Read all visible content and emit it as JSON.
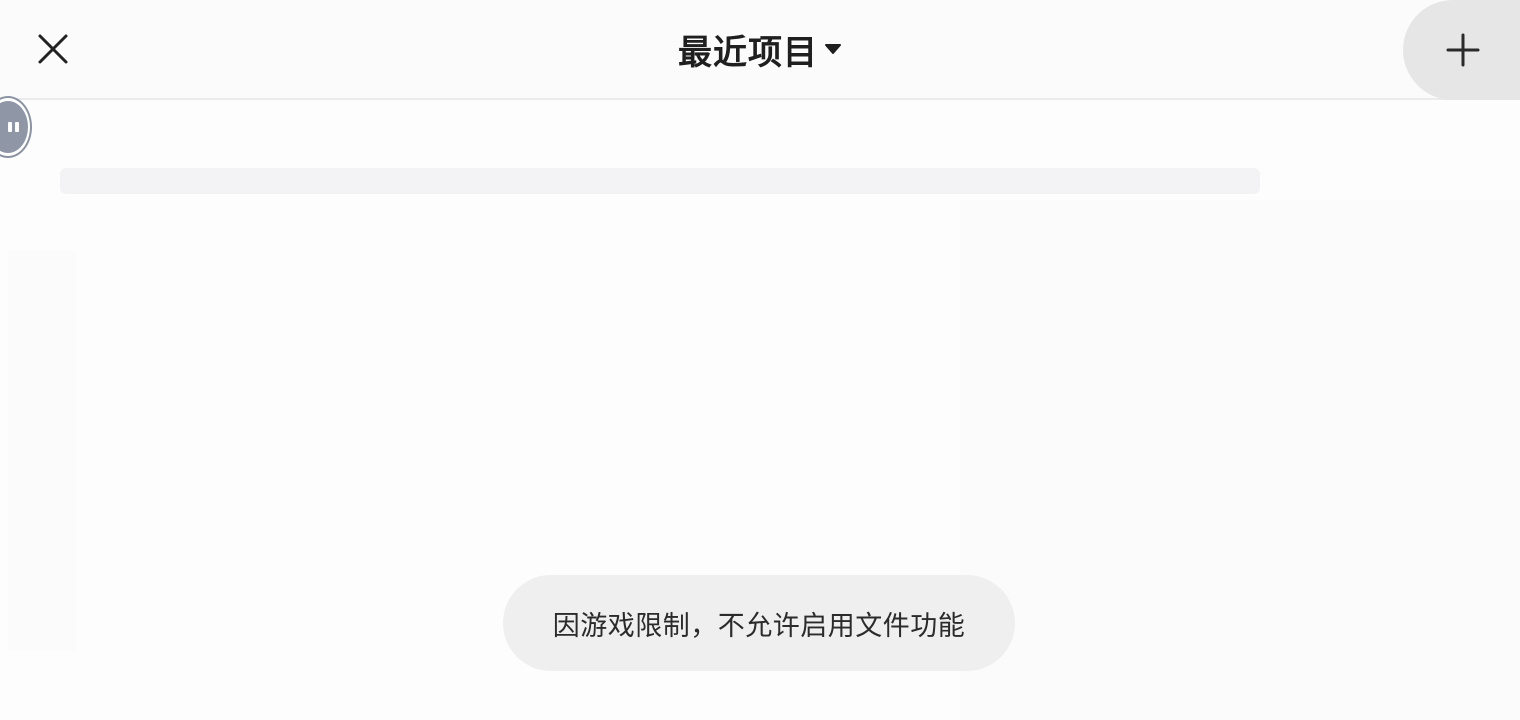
{
  "header": {
    "title": "最近项目",
    "close_icon": "close-icon",
    "dropdown_icon": "caret-down-icon",
    "add_icon": "plus-icon"
  },
  "floating_button": {
    "icon": "pause-icon"
  },
  "toast": {
    "message": "因游戏限制，不允许启用文件功能"
  },
  "colors": {
    "background": "#fdfdfd",
    "header_bg": "#fbfbfb",
    "add_button_bg": "#e6e6e7",
    "toast_bg": "#efefef",
    "title_text": "#1f1f1f",
    "float_button": "#8f97a6"
  }
}
